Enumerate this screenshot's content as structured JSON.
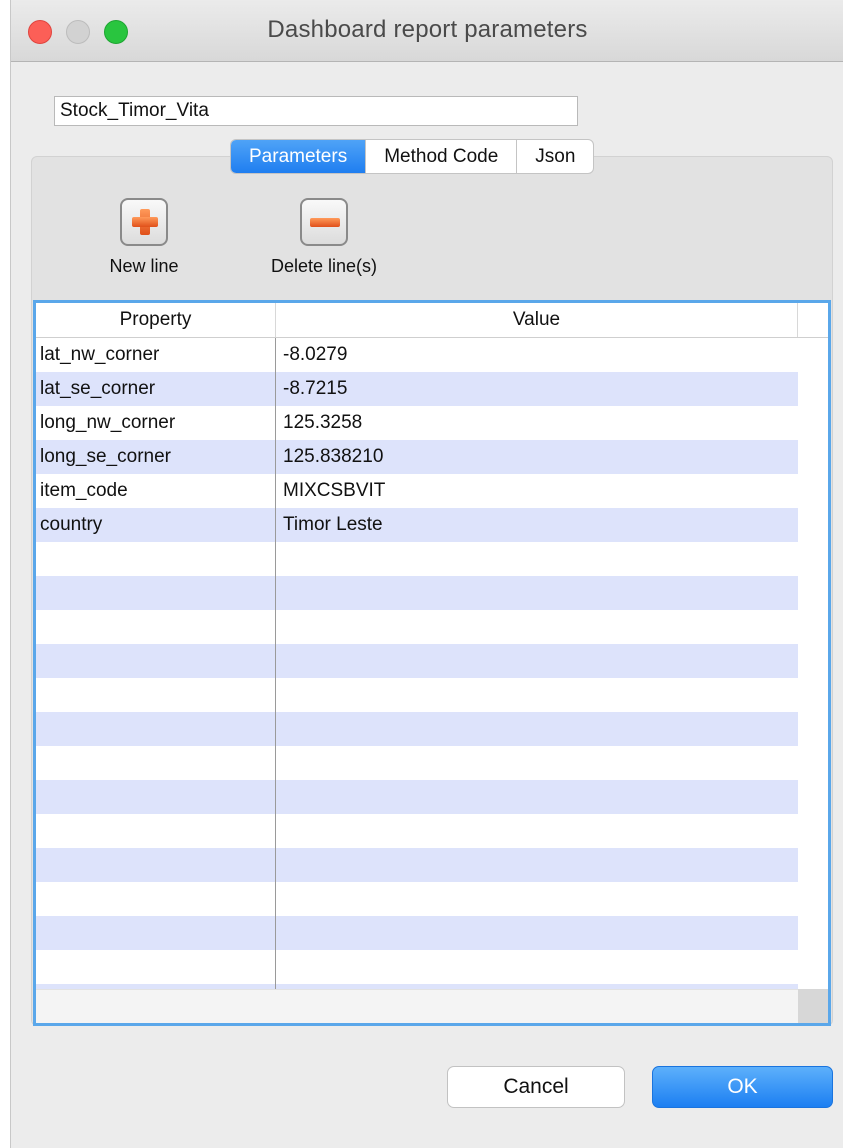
{
  "window": {
    "title": "Dashboard report parameters"
  },
  "report_name": "Stock_Timor_Vita",
  "tabs": [
    {
      "label": "Parameters",
      "active": true
    },
    {
      "label": "Method Code",
      "active": false
    },
    {
      "label": "Json",
      "active": false
    }
  ],
  "toolbar": {
    "new_line": "New line",
    "delete_lines": "Delete line(s)"
  },
  "table": {
    "headers": {
      "property": "Property",
      "value": "Value"
    },
    "rows": [
      {
        "property": "lat_nw_corner",
        "value": "-8.0279"
      },
      {
        "property": "lat_se_corner",
        "value": "-8.7215"
      },
      {
        "property": "long_nw_corner",
        "value": "125.3258"
      },
      {
        "property": "long_se_corner",
        "value": "125.838210"
      },
      {
        "property": "item_code",
        "value": "MIXCSBVIT"
      },
      {
        "property": "country",
        "value": "Timor Leste"
      },
      {
        "property": "",
        "value": ""
      },
      {
        "property": "",
        "value": ""
      },
      {
        "property": "",
        "value": ""
      },
      {
        "property": "",
        "value": ""
      },
      {
        "property": "",
        "value": ""
      },
      {
        "property": "",
        "value": ""
      },
      {
        "property": "",
        "value": ""
      },
      {
        "property": "",
        "value": ""
      },
      {
        "property": "",
        "value": ""
      },
      {
        "property": "",
        "value": ""
      },
      {
        "property": "",
        "value": ""
      },
      {
        "property": "",
        "value": ""
      },
      {
        "property": "",
        "value": ""
      },
      {
        "property": "",
        "value": ""
      }
    ]
  },
  "buttons": {
    "cancel": "Cancel",
    "ok": "OK"
  },
  "colors": {
    "accent": "#1f7ef0",
    "row_stripe": "#dde3fb",
    "table_focus_border": "#5aa7ea"
  },
  "icons": {
    "add": "plus-icon",
    "delete": "minus-icon"
  }
}
